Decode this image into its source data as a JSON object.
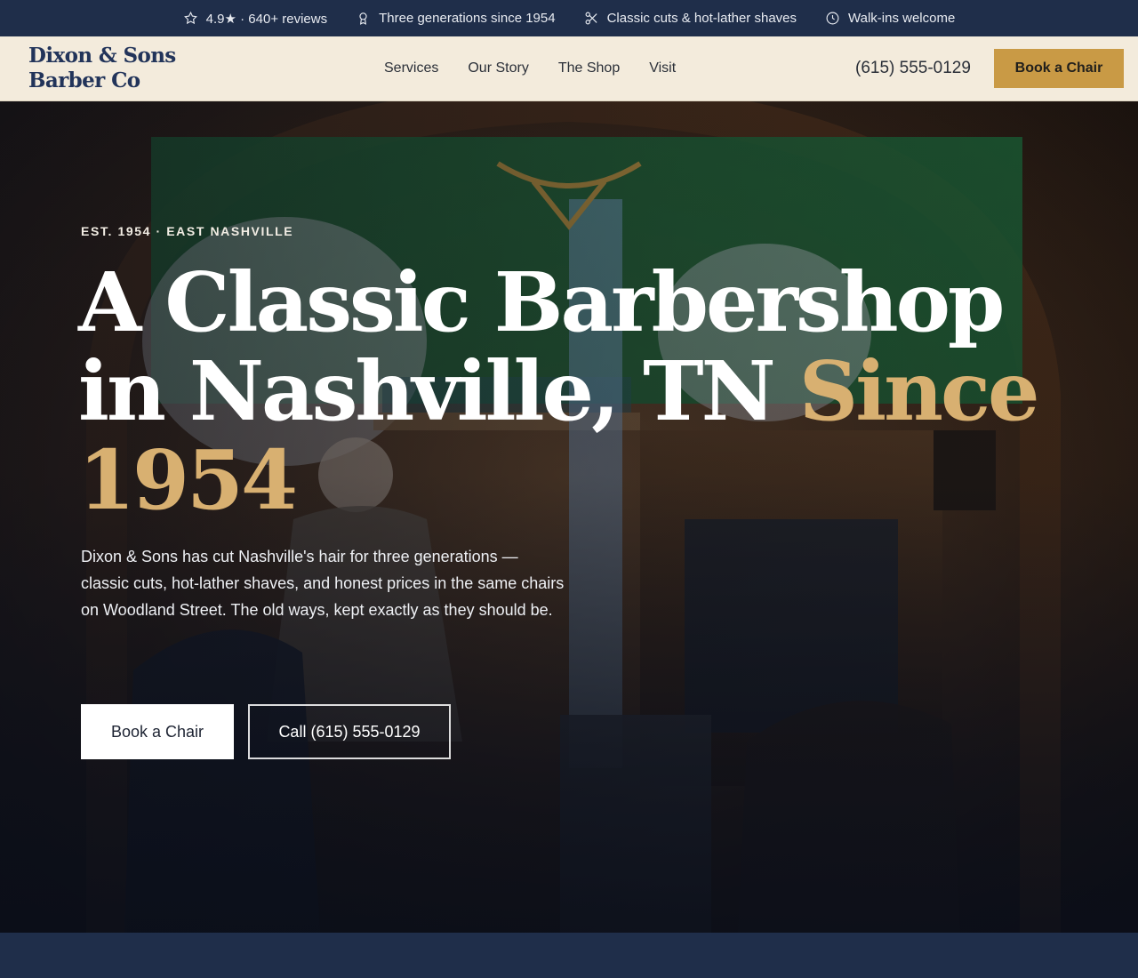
{
  "topbar": {
    "items": [
      {
        "icon": "star-icon",
        "text": "4.9★ · 640+ reviews"
      },
      {
        "icon": "award-icon",
        "text": "Three generations since 1954"
      },
      {
        "icon": "scissors-icon",
        "text": "Classic cuts & hot-lather shaves"
      },
      {
        "icon": "clock-icon",
        "text": "Walk-ins welcome"
      }
    ]
  },
  "header": {
    "logo_line1": "Dixon & Sons",
    "logo_line2": "Barber Co",
    "nav": [
      "Services",
      "Our Story",
      "The Shop",
      "Visit"
    ],
    "phone": "(615) 555-0129",
    "cta": "Book a Chair"
  },
  "hero": {
    "eyebrow": "EST. 1954 · EAST NASHVILLE",
    "headline_main": "A Classic Barbershop in Nashville, TN ",
    "headline_accent": "Since 1954",
    "lead": "Dixon & Sons has cut Nashville's hair for three generations — classic cuts, hot-lather shaves, and honest prices in the same chairs on Woodland Street. The old ways, kept exactly as they should be.",
    "primary_cta": "Book a Chair",
    "secondary_cta": "Call (615) 555-0129"
  },
  "colors": {
    "navy": "#1f2e4a",
    "cream": "#f3ebdc",
    "gold": "#c99a45",
    "accent_text": "#d8b071"
  }
}
